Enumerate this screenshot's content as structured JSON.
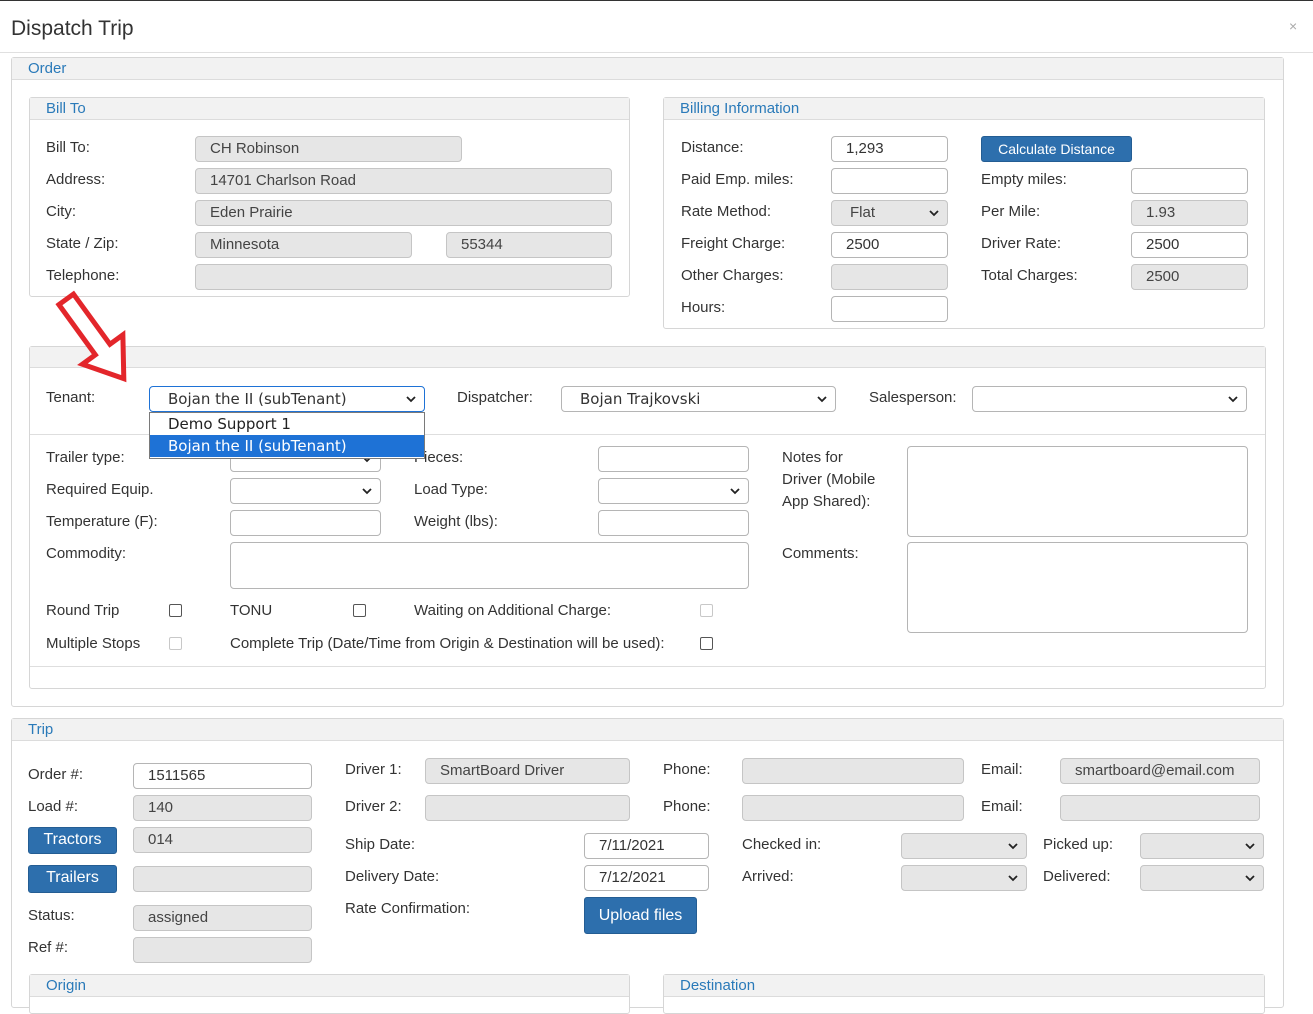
{
  "dialog": {
    "title": "Dispatch Trip",
    "close": "×"
  },
  "order": {
    "legend": "Order",
    "bill_to": {
      "legend": "Bill To",
      "labels": {
        "bill_to": "Bill To:",
        "address": "Address:",
        "city": "City:",
        "state_zip": "State / Zip:",
        "telephone": "Telephone:"
      },
      "values": {
        "bill_to": "CH Robinson",
        "address": "14701 Charlson Road",
        "city": "Eden Prairie",
        "state": "Minnesota",
        "zip": "55344",
        "telephone": ""
      }
    },
    "billing": {
      "legend": "Billing Information",
      "labels": {
        "distance": "Distance:",
        "paid_emp_miles": "Paid Emp. miles:",
        "rate_method": "Rate Method:",
        "freight_charge": "Freight Charge:",
        "other_charges": "Other Charges:",
        "hours": "Hours:",
        "empty_miles": "Empty miles:",
        "per_mile": "Per Mile:",
        "driver_rate": "Driver Rate:",
        "total_charges": "Total Charges:"
      },
      "values": {
        "distance": "1,293",
        "paid_emp_miles": "",
        "rate_method": "Flat",
        "freight_charge": "2500",
        "other_charges": "",
        "hours": "",
        "empty_miles": "",
        "per_mile": "1.93",
        "driver_rate": "2500",
        "total_charges": "2500"
      },
      "calculate_button": "Calculate Distance"
    },
    "assignment": {
      "tenant_label": "Tenant:",
      "tenant_value": "Bojan the II (subTenant)",
      "tenant_options": [
        "Demo Support 1",
        "Bojan the II (subTenant)"
      ],
      "tenant_selected_index": 1,
      "dispatcher_label": "Dispatcher:",
      "dispatcher_value": "Bojan Trajkovski",
      "salesperson_label": "Salesperson:",
      "salesperson_value": ""
    },
    "details": {
      "trailer_type": "Trailer type:",
      "required_equip": "Required Equip.",
      "temperature": "Temperature (F):",
      "commodity": "Commodity:",
      "pieces": "Pieces:",
      "load_type": "Load Type:",
      "weight": "Weight (lbs):",
      "notes_line1": "Notes for",
      "notes_line2": "Driver (Mobile",
      "notes_line3": "App Shared):",
      "comments": "Comments:",
      "round_trip": "Round Trip",
      "tonu": "TONU",
      "waiting_charge": "Waiting on Additional Charge:",
      "multiple_stops": "Multiple Stops",
      "complete_trip": "Complete Trip (Date/Time from Origin & Destination will be used):"
    }
  },
  "trip": {
    "legend": "Trip",
    "labels": {
      "order_no": "Order #:",
      "load_no": "Load #:",
      "status": "Status:",
      "ref_no": "Ref #:",
      "driver1": "Driver 1:",
      "driver2": "Driver 2:",
      "ship_date": "Ship Date:",
      "delivery_date": "Delivery Date:",
      "rate_confirmation": "Rate Confirmation:",
      "phone": "Phone:",
      "email": "Email:",
      "checked_in": "Checked in:",
      "arrived": "Arrived:",
      "picked_up": "Picked up:",
      "delivered": "Delivered:"
    },
    "values": {
      "order_no": "1511565",
      "load_no": "140",
      "tractor": "014",
      "trailer": "",
      "status": "assigned",
      "ref_no": "",
      "driver1": "SmartBoard Driver",
      "driver2": "",
      "ship_date": "7/11/2021",
      "delivery_date": "7/12/2021",
      "phone1": "",
      "phone2": "",
      "email1": "smartboard@email.com",
      "email2": ""
    },
    "buttons": {
      "tractors": "Tractors",
      "trailers": "Trailers",
      "upload": "Upload files"
    },
    "origin_legend": "Origin",
    "destination_legend": "Destination"
  },
  "colors": {
    "accent": "#2a7ab9",
    "button": "#2d6fad",
    "selection": "#1e72d6",
    "arrow": "#e3262b"
  }
}
